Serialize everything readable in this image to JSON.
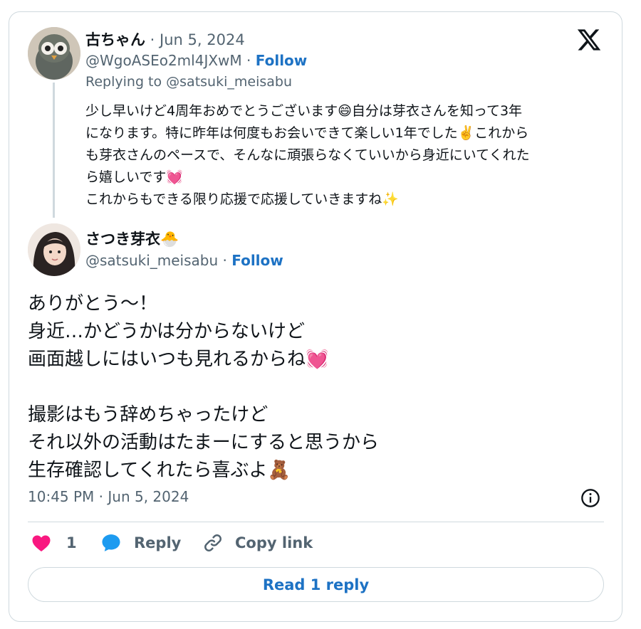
{
  "parent_tweet": {
    "name": "古ちゃん",
    "date_sep": " · ",
    "date": "Jun 5, 2024",
    "handle": "@WgoASEo2ml4JXwM",
    "handle_sep": " · ",
    "follow_label": "Follow",
    "replying_to": "Replying to @satsuki_meisabu",
    "body_lines": [
      "少し早いけど4周年おめでとうございます😄自分は芽衣さんを知って3年",
      "になります。特に昨年は何度もお会いできて楽しい1年でした✌️これから",
      "も芽衣さんのペースで、そんなに頑張らなくていいから身近にいてくれた",
      "ら嬉しいです💓",
      "これからもできる限り応援で応援していきますね✨"
    ]
  },
  "main_tweet": {
    "name": "さつき芽衣🐣",
    "handle": "@satsuki_meisabu",
    "handle_sep": " · ",
    "follow_label": "Follow",
    "body_lines": [
      "ありがとう〜！",
      "身近…かどうかは分からないけど",
      "画面越しにはいつも見れるからね💓",
      "",
      "撮影はもう辞めちゃったけど",
      "それ以外の活動はたまーにすると思うから",
      "生存確認してくれたら喜ぶよ🧸"
    ],
    "timestamp": "10:45 PM · Jun 5, 2024"
  },
  "actions": {
    "like_count": "1",
    "reply_label": "Reply",
    "copy_link_label": "Copy link"
  },
  "read_replies_label": "Read 1 reply",
  "icons": {
    "brand": "x-logo-icon",
    "like": "heart-icon",
    "reply": "speech-bubble-icon",
    "copy": "link-icon",
    "info": "info-icon"
  },
  "colors": {
    "like": "#f91880",
    "reply": "#1d9bf0",
    "follow": "#1d72c4",
    "muted": "#536471",
    "border": "#cfd9de"
  }
}
